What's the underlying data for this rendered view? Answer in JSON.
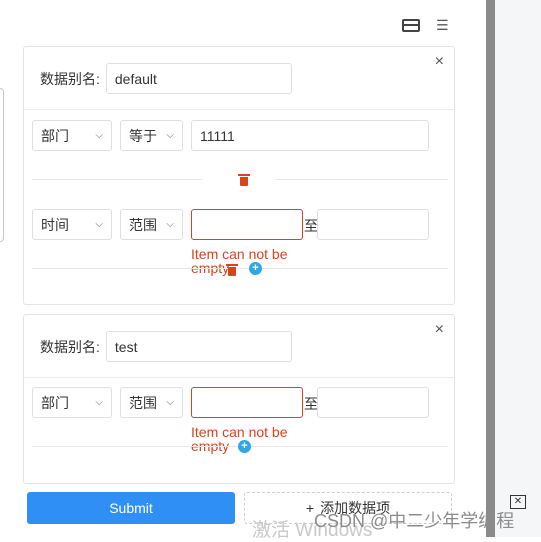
{
  "toolbar": {
    "card_icon": "card-view-icon",
    "list_icon": "list-view-icon"
  },
  "cards": [
    {
      "close": "×",
      "alias_label": "数据别名:",
      "alias_value": "default",
      "rows": [
        {
          "field": "部门",
          "op": "等于",
          "value": "11111",
          "error": ""
        },
        {
          "field": "时间",
          "op": "范围",
          "value": "",
          "to": "至",
          "error": "Item can not be empty"
        }
      ]
    },
    {
      "close": "×",
      "alias_label": "数据别名:",
      "alias_value": "test",
      "rows": [
        {
          "field": "部门",
          "op": "范围",
          "value": "",
          "to": "至",
          "error": "Item can not be empty"
        }
      ]
    }
  ],
  "footer": {
    "submit_label": "Submit",
    "add_label": "添加数据项",
    "add_icon": "+"
  },
  "watermark": {
    "windows": "激活 Windows",
    "csdn": "CSDN @中二少年学编程"
  },
  "colors": {
    "primary": "#2f8ff5",
    "error": "#d9431e",
    "add_icon": "#2ea8e5"
  }
}
